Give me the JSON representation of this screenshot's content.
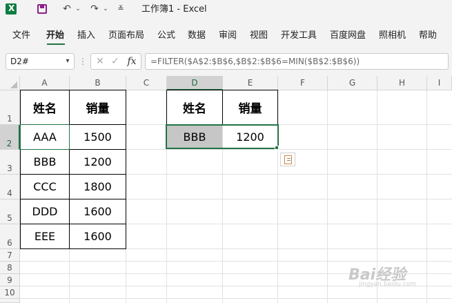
{
  "window": {
    "title": "工作簿1  -  Excel"
  },
  "quick_access": {
    "save_icon": "save-icon",
    "undo_icon": "undo-icon",
    "redo_icon": "redo-icon",
    "more_icon": "customize-icon"
  },
  "ribbon": {
    "tabs": [
      "文件",
      "开始",
      "插入",
      "页面布局",
      "公式",
      "数据",
      "审阅",
      "视图",
      "开发工具",
      "百度网盘",
      "照相机",
      "帮助"
    ],
    "active_tab": "开始",
    "accent_color": "#217346"
  },
  "formula_bar": {
    "name_box": "D2#",
    "dots": "⋮",
    "fx_label": "fx",
    "formula": "=FILTER($A$2:$B$6,$B$2:$B$6=MIN($B$2:$B$6))"
  },
  "grid": {
    "columns": [
      "A",
      "B",
      "C",
      "D",
      "E",
      "F",
      "G",
      "H",
      "I"
    ],
    "rows": [
      "1",
      "2",
      "3",
      "4",
      "5",
      "6",
      "7",
      "8",
      "9",
      "10"
    ],
    "selected_cell": "D2",
    "source_table": {
      "headers": [
        "姓名",
        "销量"
      ],
      "rows": [
        [
          "AAA",
          "1500"
        ],
        [
          "BBB",
          "1200"
        ],
        [
          "CCC",
          "1800"
        ],
        [
          "DDD",
          "1600"
        ],
        [
          "EEE",
          "1600"
        ]
      ]
    },
    "result_table": {
      "headers": [
        "姓名",
        "销量"
      ],
      "rows": [
        [
          "BBB",
          "1200"
        ]
      ]
    }
  },
  "watermark": {
    "text": "Bai经验",
    "sub": "jingyan.baidu.com"
  }
}
